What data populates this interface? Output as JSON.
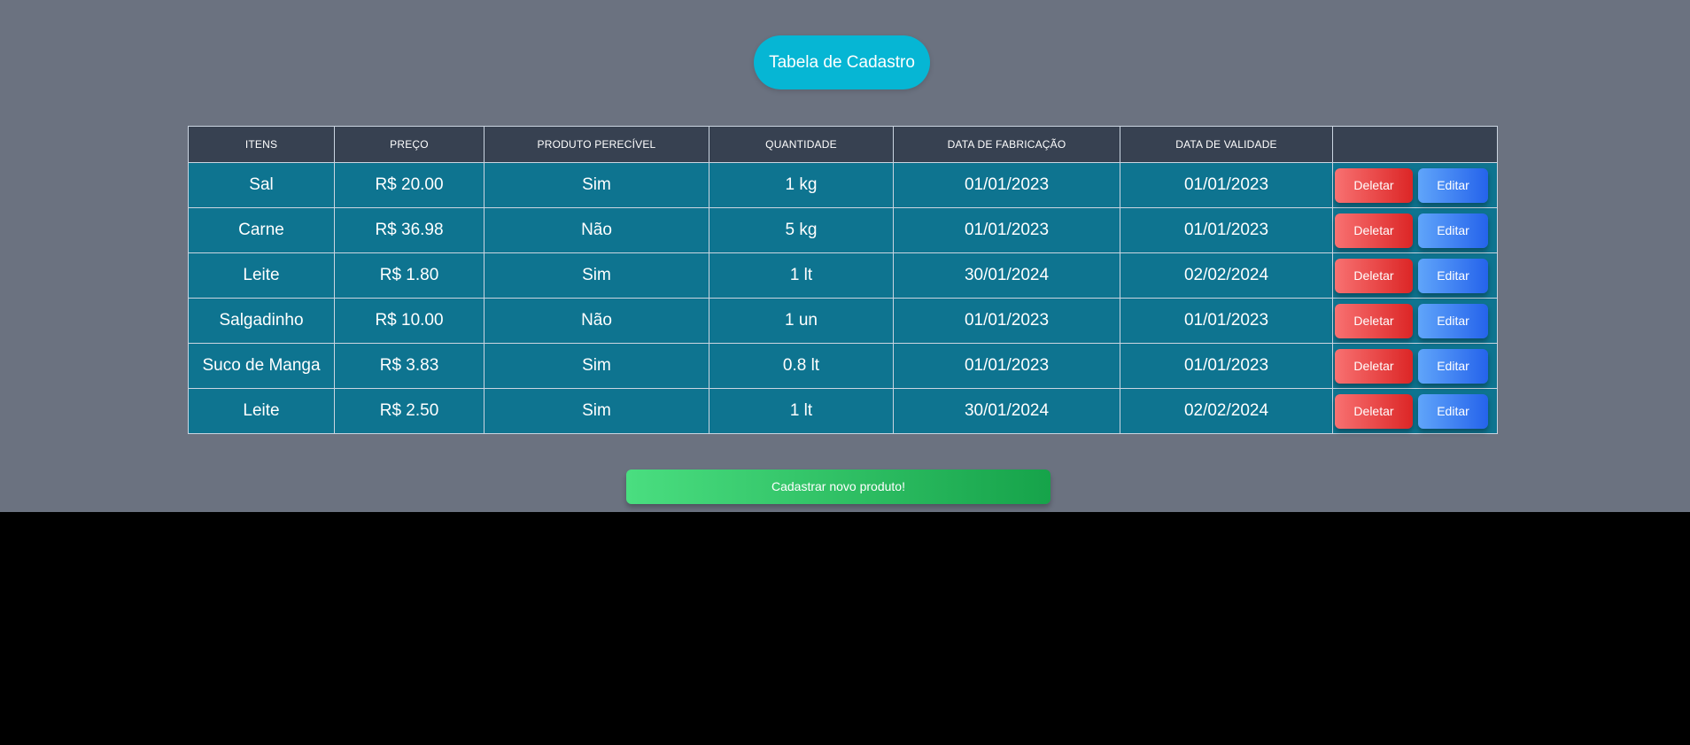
{
  "header": {
    "title": "Tabela de Cadastro"
  },
  "table": {
    "columns": [
      "ITENS",
      "PREÇO",
      "PRODUTO PERECÍVEL",
      "QUANTIDADE",
      "DATA DE FABRICAÇÃO",
      "DATA DE VALIDADE",
      ""
    ],
    "rows": [
      {
        "item": "Sal",
        "price": "R$ 20.00",
        "perishable": "Sim",
        "quantity": "1 kg",
        "manufactured": "01/01/2023",
        "expires": "01/01/2023"
      },
      {
        "item": "Carne",
        "price": "R$ 36.98",
        "perishable": "Não",
        "quantity": "5 kg",
        "manufactured": "01/01/2023",
        "expires": "01/01/2023"
      },
      {
        "item": "Leite",
        "price": "R$ 1.80",
        "perishable": "Sim",
        "quantity": "1 lt",
        "manufactured": "30/01/2024",
        "expires": "02/02/2024"
      },
      {
        "item": "Salgadinho",
        "price": "R$ 10.00",
        "perishable": "Não",
        "quantity": "1 un",
        "manufactured": "01/01/2023",
        "expires": "01/01/2023"
      },
      {
        "item": "Suco de Manga",
        "price": "R$ 3.83",
        "perishable": "Sim",
        "quantity": "0.8 lt",
        "manufactured": "01/01/2023",
        "expires": "01/01/2023"
      },
      {
        "item": "Leite",
        "price": "R$ 2.50",
        "perishable": "Sim",
        "quantity": "1 lt",
        "manufactured": "30/01/2024",
        "expires": "02/02/2024"
      }
    ],
    "actions": {
      "delete_label": "Deletar",
      "edit_label": "Editar"
    }
  },
  "footer": {
    "register_label": "Cadastrar novo produto!"
  },
  "colors": {
    "page_background": "#6b7280",
    "header_background": "#374151",
    "row_background": "#0e7490",
    "title_pill": "#06b6d4",
    "delete_button": "#ef4444",
    "edit_button": "#3b82f6",
    "register_button": "#22c55e"
  }
}
